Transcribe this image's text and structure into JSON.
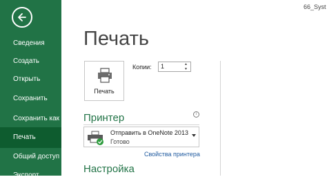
{
  "window": {
    "file_name": "66_Syst"
  },
  "sidebar": {
    "items": [
      {
        "label": "Сведения"
      },
      {
        "label": "Создать"
      },
      {
        "label": "Открыть"
      },
      {
        "label": "Сохранить"
      },
      {
        "label": "Сохранить как"
      },
      {
        "label": "Печать",
        "active": true
      },
      {
        "label": "Общий доступ"
      },
      {
        "label": "Экспорт"
      }
    ]
  },
  "main": {
    "title": "Печать",
    "print_button_label": "Печать",
    "copies": {
      "label": "Копии:",
      "value": "1"
    },
    "printer_section": {
      "title": "Принтер",
      "info_icon": "i",
      "selected_printer": "Отправить в OneNote 2013",
      "status": "Готово",
      "properties_link": "Свойства принтера"
    },
    "settings_section": {
      "title": "Настройка"
    }
  },
  "colors": {
    "sidebar_bg": "#217346",
    "sidebar_active_bg": "#0e5c2f",
    "accent": "#217346",
    "link": "#1f5a9f"
  },
  "icons": {
    "back": "back-arrow-icon",
    "printer": "printer-icon",
    "onenote_printer": "printer-check-icon",
    "spinner": "spinner-icon"
  }
}
